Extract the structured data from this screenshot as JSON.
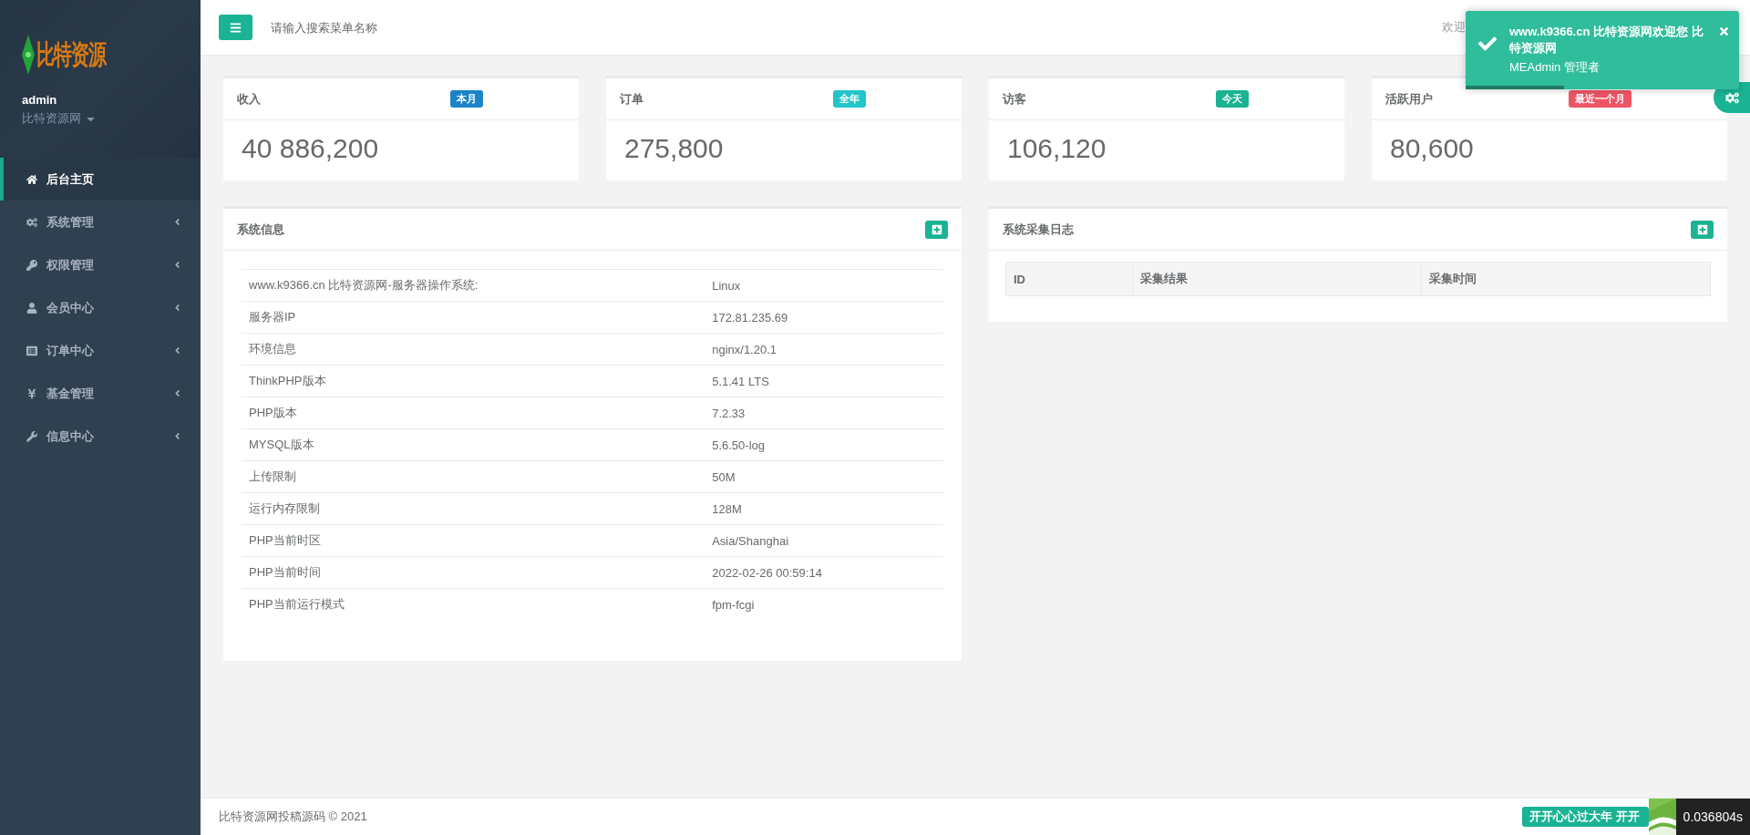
{
  "sidebar": {
    "logo_text": "比特资源",
    "user": "admin",
    "site": "比特资源网",
    "items": [
      {
        "label": "后台主页",
        "selected": true,
        "has_arrow": false
      },
      {
        "label": "系统管理",
        "selected": false,
        "has_arrow": true
      },
      {
        "label": "权限管理",
        "selected": false,
        "has_arrow": true
      },
      {
        "label": "会员中心",
        "selected": false,
        "has_arrow": true
      },
      {
        "label": "订单中心",
        "selected": false,
        "has_arrow": true
      },
      {
        "label": "基金管理",
        "selected": false,
        "has_arrow": true
      },
      {
        "label": "信息中心",
        "selected": false,
        "has_arrow": true
      }
    ]
  },
  "header": {
    "search_placeholder": "请输入搜索菜单名称",
    "welcome": "欢迎"
  },
  "toast": {
    "title": "www.k9366.cn 比特资源网欢迎您 比特资源网",
    "message": "MEAdmin 管理者",
    "level": 0.36
  },
  "stats": [
    {
      "title": "收入",
      "badge": "本月",
      "color": "#1c84c6",
      "value": "40 886,200"
    },
    {
      "title": "订单",
      "badge": "全年",
      "color": "#23c6c8",
      "value": "275,800"
    },
    {
      "title": "访客",
      "badge": "今天",
      "color": "#1ab394",
      "value": "106,120"
    },
    {
      "title": "活跃用户",
      "badge": "最近一个月",
      "color": "#ed5565",
      "value": "80,600"
    }
  ],
  "system_info": {
    "title": "系统信息",
    "rows": [
      [
        "www.k9366.cn 比特资源网-服务器操作系统:",
        "Linux"
      ],
      [
        "服务器IP",
        "172.81.235.69"
      ],
      [
        "环境信息",
        "nginx/1.20.1"
      ],
      [
        "ThinkPHP版本",
        "5.1.41 LTS"
      ],
      [
        "PHP版本",
        "7.2.33"
      ],
      [
        "MYSQL版本",
        "5.6.50-log"
      ],
      [
        "上传限制",
        "50M"
      ],
      [
        "运行内存限制",
        "128M"
      ],
      [
        "PHP当前时区",
        "Asia/Shanghai"
      ],
      [
        "PHP当前时间",
        "2022-02-26 00:59:14"
      ],
      [
        "PHP当前运行模式",
        "fpm-fcgi"
      ]
    ]
  },
  "collect_log": {
    "title": "系统采集日志",
    "columns": [
      "ID",
      "采集结果",
      "采集时间"
    ]
  },
  "footer": {
    "copyright": "比特资源网投稿源码 © 2021",
    "marquee": "开开心心过大年 开开",
    "timing": "0.036804s"
  }
}
